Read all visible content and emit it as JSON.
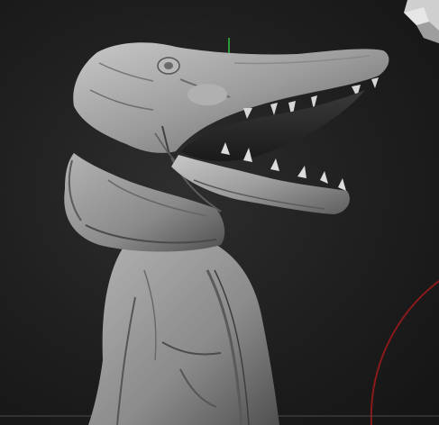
{
  "viewport": {
    "background": "#1c1c1c",
    "model_color": "#9a9a9a",
    "rotation_ring_color": "#8a1a1a",
    "gizmo_axis_color": "#2fbf3f"
  },
  "icons": {
    "corner_widget": "navigation-cube-icon",
    "ring": "rotation-ring-icon",
    "gizmo": "gizmo-y-axis-icon"
  }
}
